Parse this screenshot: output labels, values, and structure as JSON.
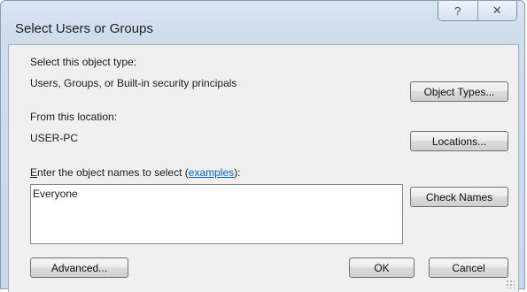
{
  "dialog": {
    "title": "Select Users or Groups",
    "help_symbol": "?",
    "close_symbol": "✕"
  },
  "object_type": {
    "label": "Select this object type:",
    "value": "Users, Groups, or Built-in security principals",
    "button": "Object Types..."
  },
  "location": {
    "label": "From this location:",
    "value": "USER-PC",
    "button": "Locations..."
  },
  "names": {
    "label_mnemonic": "E",
    "label_rest": "nter the object names to select (",
    "link": "examples",
    "label_end": "):",
    "value": "Everyone",
    "check_button": "Check Names"
  },
  "footer": {
    "advanced_button": "Advanced...",
    "ok_button": "OK",
    "cancel_button": "Cancel"
  }
}
